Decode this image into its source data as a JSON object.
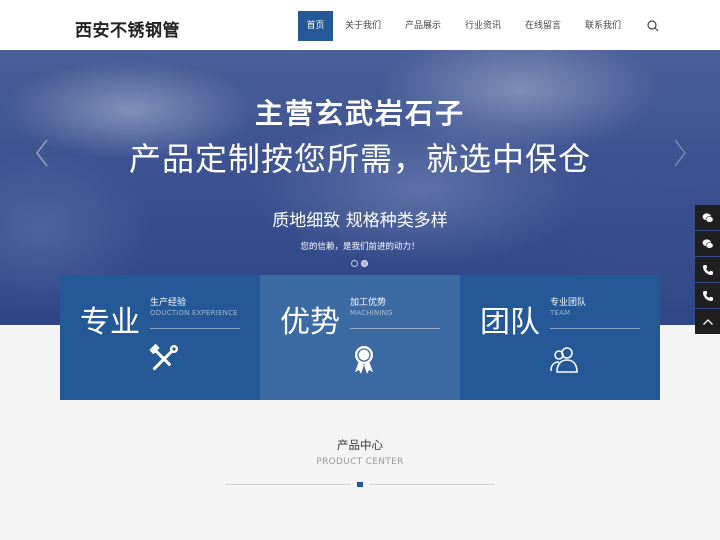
{
  "header": {
    "logo": "西安不锈钢管",
    "nav": [
      {
        "label": "首页",
        "active": true
      },
      {
        "label": "关于我们",
        "active": false
      },
      {
        "label": "产品展示",
        "active": false
      },
      {
        "label": "行业资讯",
        "active": false
      },
      {
        "label": "在线留言",
        "active": false
      },
      {
        "label": "联系我们",
        "active": false
      }
    ],
    "search_icon": "search-icon"
  },
  "banner": {
    "title": "主营玄武岩石子",
    "subtitle": "产品定制按您所需，就选中保仓",
    "tagline": "质地细致  规格种类多样",
    "note": "您的信赖，是我们前进的动力！",
    "slides_total": 2,
    "slide_active": 2
  },
  "features": [
    {
      "big": "专业",
      "title": "生产经验",
      "sub": "ODUCTION EXPERIENCE",
      "icon": "tools-icon"
    },
    {
      "big": "优势",
      "title": "加工优势",
      "sub": "MACHINING",
      "icon": "award-icon"
    },
    {
      "big": "团队",
      "title": "专业团队",
      "sub": "TEAM",
      "icon": "users-icon"
    }
  ],
  "section": {
    "title": "产品中心",
    "subtitle": "PRODUCT CENTER"
  },
  "sidebar": [
    "wechat-icon",
    "wechat-icon",
    "phone-icon",
    "phone-icon",
    "arrow-up-icon"
  ],
  "colors": {
    "primary": "#245896",
    "primary_light": "#3c6aa3",
    "sidebar": "#1f1f1f"
  }
}
